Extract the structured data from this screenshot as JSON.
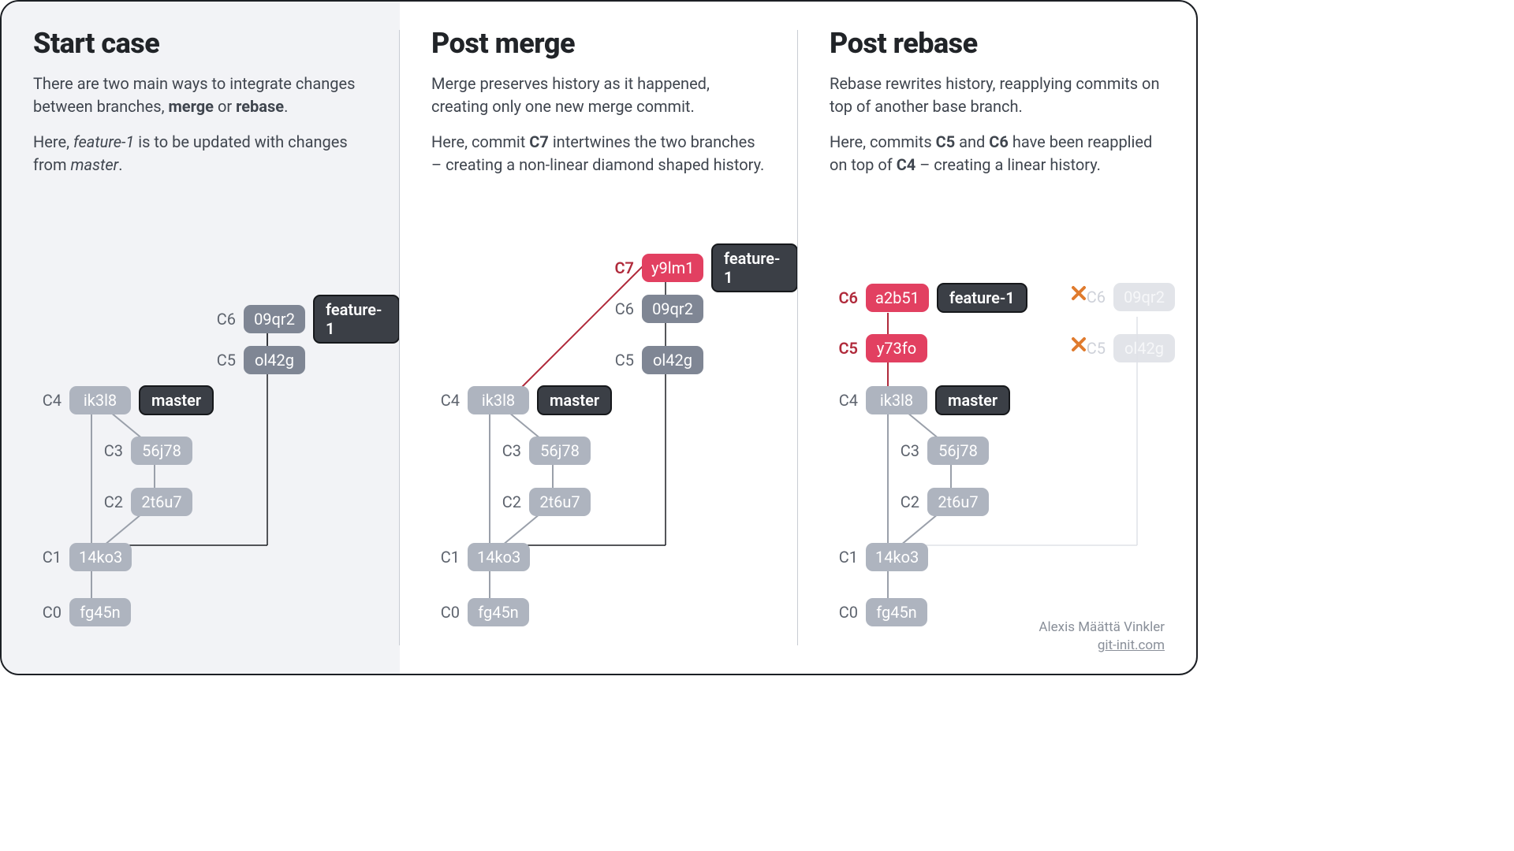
{
  "credit": {
    "author": "Alexis Määttä Vinkler",
    "site": "git-init.com"
  },
  "cols": {
    "start": {
      "title": "Start case",
      "p1_pre": "There are two main ways to integrate changes between branches, ",
      "p1_b1": "merge",
      "p1_mid": " or ",
      "p1_b2": "rebase",
      "p1_post": ".",
      "p2_pre": "Here, ",
      "p2_i1": "feature-1",
      "p2_mid": " is to be updated with changes from ",
      "p2_i2": "master",
      "p2_post": "."
    },
    "merge": {
      "title": "Post merge",
      "p1": "Merge preserves history as it happened, creating only one new merge commit.",
      "p2_pre": "Here, commit ",
      "p2_b1": "C7",
      "p2_post": " intertwines the two branches – creating a non-linear diamond shaped history."
    },
    "rebase": {
      "title": "Post rebase",
      "p1": "Rebase rewrites history, reapplying commits on top of another base branch.",
      "p2_pre": "Here, commits ",
      "p2_b1": "C5",
      "p2_mid": " and ",
      "p2_b2": "C6",
      "p2_mid2": " have been reapplied on top of ",
      "p2_b3": "C4",
      "p2_post": " – creating a linear history."
    }
  },
  "commits": {
    "c0": {
      "label": "C0",
      "hash": "fg45n"
    },
    "c1": {
      "label": "C1",
      "hash": "14ko3"
    },
    "c2": {
      "label": "C2",
      "hash": "2t6u7"
    },
    "c3": {
      "label": "C3",
      "hash": "56j78"
    },
    "c4": {
      "label": "C4",
      "hash": "ik3l8"
    },
    "c5": {
      "label": "C5",
      "hash": "ol42g"
    },
    "c6": {
      "label": "C6",
      "hash": "09qr2"
    },
    "c7": {
      "label": "C7",
      "hash": "y9lm1"
    },
    "r5": {
      "label": "C5",
      "hash": "y73fo"
    },
    "r6": {
      "label": "C6",
      "hash": "a2b51"
    }
  },
  "branches": {
    "master": "master",
    "feature": "feature-1"
  }
}
